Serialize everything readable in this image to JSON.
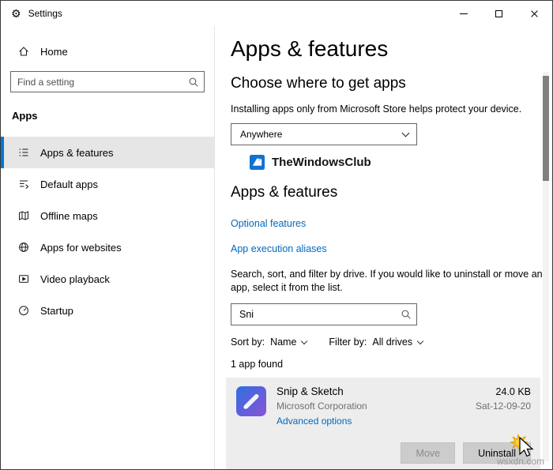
{
  "window": {
    "title": "Settings"
  },
  "icons": {
    "settings_gear": "⚙"
  },
  "sidebar": {
    "home_label": "Home",
    "search_placeholder": "Find a setting",
    "section_label": "Apps",
    "items": [
      {
        "label": "Apps & features",
        "selected": true
      },
      {
        "label": "Default apps",
        "selected": false
      },
      {
        "label": "Offline maps",
        "selected": false
      },
      {
        "label": "Apps for websites",
        "selected": false
      },
      {
        "label": "Video playback",
        "selected": false
      },
      {
        "label": "Startup",
        "selected": false
      }
    ]
  },
  "content": {
    "page_title": "Apps & features",
    "choose": {
      "heading": "Choose where to get apps",
      "description": "Installing apps only from Microsoft Store helps protect your device.",
      "dropdown_value": "Anywhere"
    },
    "logo_text": "TheWindowsClub",
    "section_heading": "Apps & features",
    "links": {
      "optional_features": "Optional features",
      "app_execution_aliases": "App execution aliases"
    },
    "search": {
      "description": "Search, sort, and filter by drive. If you would like to uninstall or move an app, select it from the list.",
      "value": "Sni"
    },
    "sort": {
      "label": "Sort by:",
      "value": "Name"
    },
    "filter": {
      "label": "Filter by:",
      "value": "All drives"
    },
    "results_count": "1 app found",
    "app": {
      "name": "Snip & Sketch",
      "publisher": "Microsoft Corporation",
      "advanced_options": "Advanced options",
      "size": "24.0 KB",
      "date": "Sat-12-09-20",
      "move_label": "Move",
      "uninstall_label": "Uninstall"
    }
  },
  "watermark": "wsxdn.com",
  "colors": {
    "accent": "#0078d7",
    "link": "#0069c0",
    "selected_item_bg": "#e6e6e6",
    "card_bg": "#ededed",
    "button_bg": "#cccccc"
  }
}
